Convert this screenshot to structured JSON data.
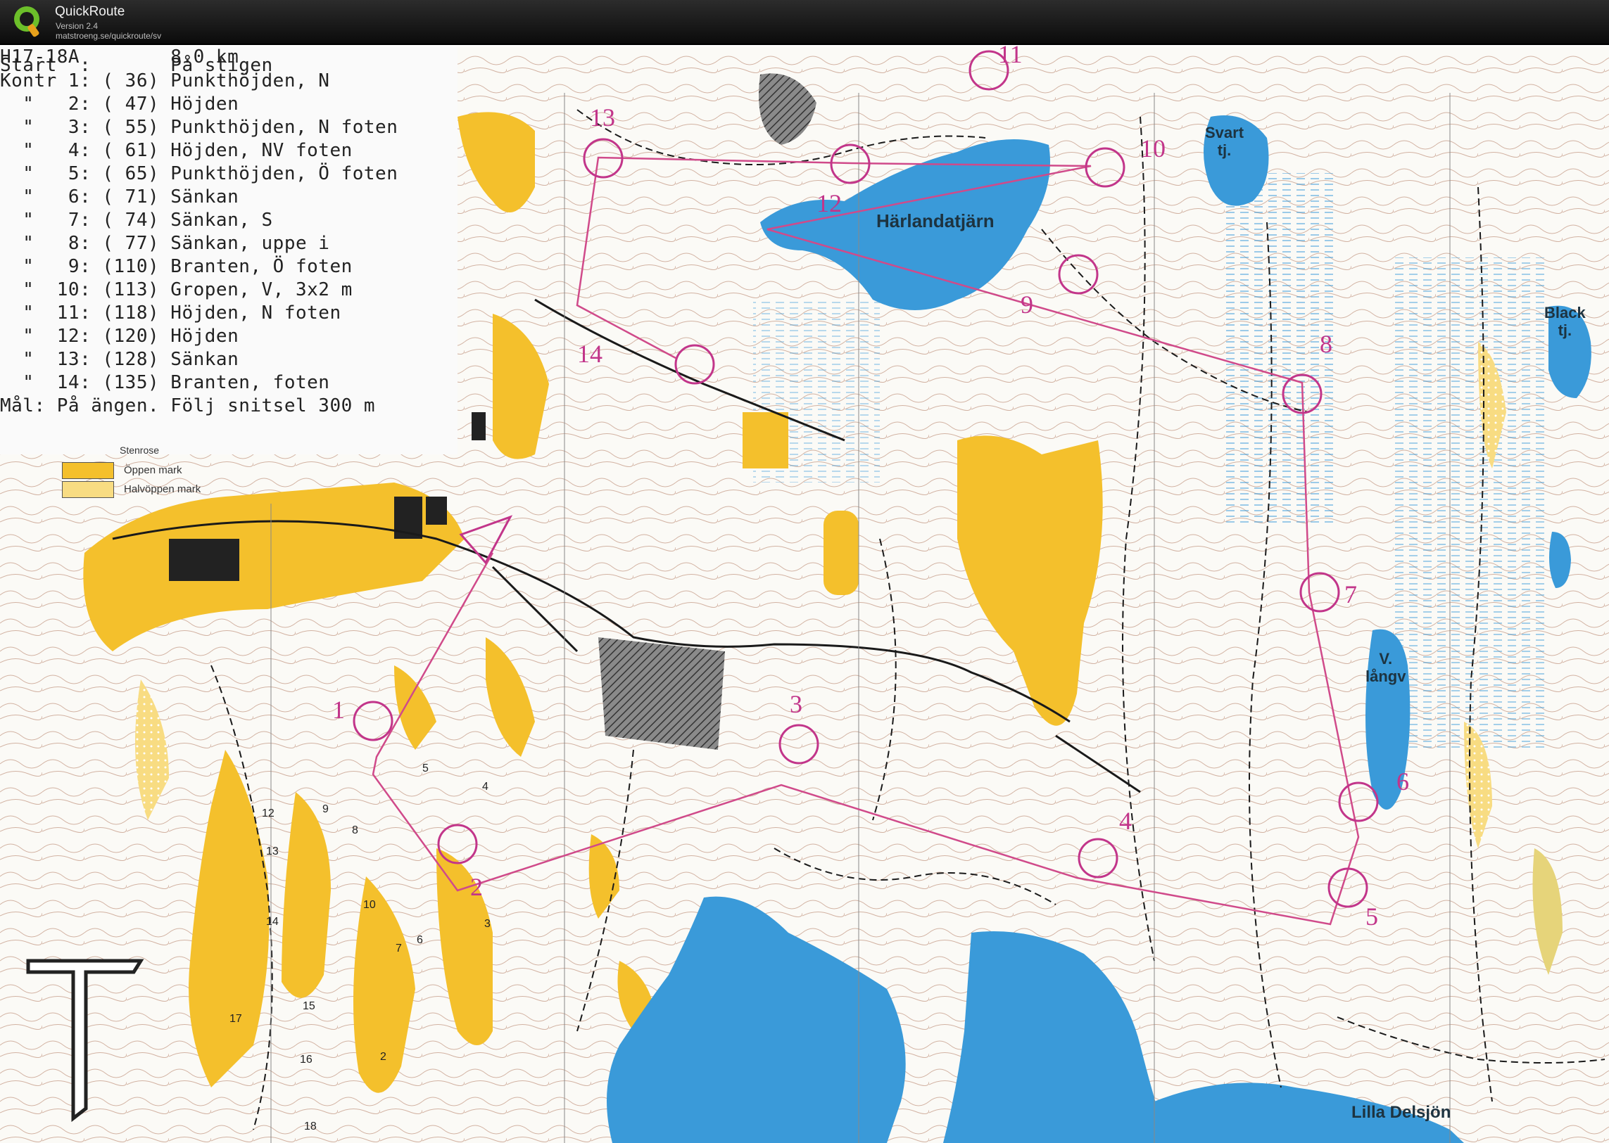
{
  "window": {
    "app_name": "QuickRoute",
    "version": "Version 2.4",
    "url": "matstroeng.se/quickroute/sv",
    "icon": "quickroute-logo-icon"
  },
  "course": {
    "lines": [
      "H17-18A        8.0 km",
      "Start  :       På stigen",
      "Kontr 1: ( 36) Punkthöjden, N",
      "  \"   2: ( 47) Höjden",
      "  \"   3: ( 55) Punkthöjden, N foten",
      "  \"   4: ( 61) Höjden, NV foten",
      "  \"   5: ( 65) Punkthöjden, Ö foten",
      "  \"   6: ( 71) Sänkan",
      "  \"   7: ( 74) Sänkan, S",
      "  \"   8: ( 77) Sänkan, uppe i",
      "  \"   9: (110) Branten, Ö foten",
      "  \"  10: (113) Gropen, V, 3x2 m",
      "  \"  11: (118) Höjden, N foten",
      "  \"  12: (120) Höjden",
      "  \"  13: (128) Sänkan",
      "  \"  14: (135) Branten, foten",
      "Mål: På ängen. Följ snitsel 300 m"
    ]
  },
  "legend": {
    "title": "Stenrose",
    "items": [
      {
        "label": "Öppen mark",
        "color": "#f4c02c"
      },
      {
        "label": "Halvöppen mark",
        "color": "#f8dc82"
      }
    ]
  },
  "lakes": {
    "harlandatjarn": "Härlandatjärn",
    "svart": "Svart\ntj.",
    "black": "Black\ntj.",
    "langv": "V.\nlångv",
    "lilla_delsjon": "Lilla Delsjön"
  },
  "controls": [
    {
      "n": "1"
    },
    {
      "n": "2"
    },
    {
      "n": "3"
    },
    {
      "n": "4"
    },
    {
      "n": "5"
    },
    {
      "n": "6"
    },
    {
      "n": "7"
    },
    {
      "n": "8"
    },
    {
      "n": "9"
    },
    {
      "n": "10"
    },
    {
      "n": "11"
    },
    {
      "n": "12"
    },
    {
      "n": "13"
    },
    {
      "n": "14"
    }
  ],
  "area_numbers": [
    "12",
    "9",
    "8",
    "13",
    "14",
    "10",
    "7",
    "6",
    "5",
    "4",
    "3",
    "15",
    "16",
    "2",
    "17",
    "18"
  ],
  "colors": {
    "water": "#3a9ad9",
    "open_land": "#f4c02c",
    "semi_open": "#f8dc82",
    "route": "#d04a8a",
    "contour": "#b77a60"
  }
}
